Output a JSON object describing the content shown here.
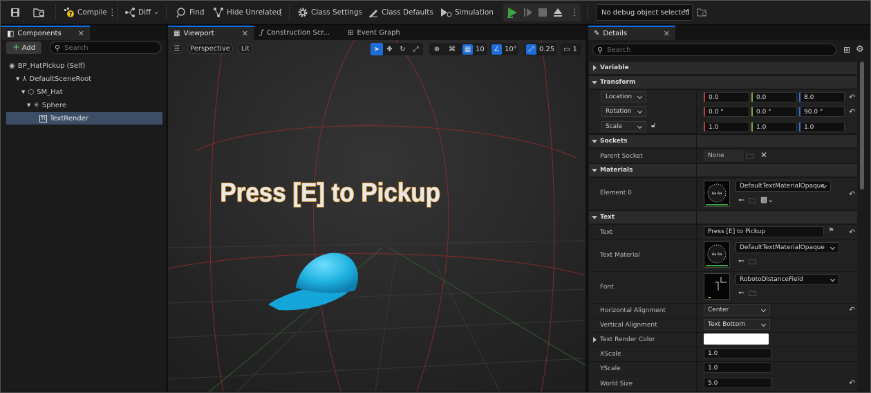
{
  "toolbar": {
    "compile": "Compile",
    "diff": "Diff",
    "find": "Find",
    "hide_unrelated": "Hide Unrelated",
    "class_settings": "Class Settings",
    "class_defaults": "Class Defaults",
    "simulation": "Simulation",
    "debug_object": "No debug object selected"
  },
  "tabs": {
    "components": "Components",
    "viewport": "Viewport",
    "construction_script": "Construction Scr...",
    "event_graph": "Event Graph",
    "details": "Details"
  },
  "components": {
    "add": "Add",
    "search_placeholder": "Search",
    "tree": [
      {
        "label": "BP_HatPickup (Self)"
      },
      {
        "label": "DefaultSceneRoot"
      },
      {
        "label": "SM_Hat"
      },
      {
        "label": "Sphere"
      },
      {
        "label": "TextRender"
      }
    ]
  },
  "viewport": {
    "perspective": "Perspective",
    "lit": "Lit",
    "grid_snap": "10",
    "rotation_snap": "10°",
    "scale_snap": "0.25",
    "camera_speed": "1",
    "text_render": "Press [E] to Pickup",
    "colors": {
      "hat": "#1fb3e0",
      "text_outline": "#f0a020",
      "grid_red": "#a82a2a",
      "grid_green": "#2f5a2f"
    }
  },
  "details": {
    "search_placeholder": "Search",
    "categories": {
      "variable": "Variable",
      "transform": "Transform",
      "sockets": "Sockets",
      "materials": "Materials",
      "text": "Text"
    },
    "transform": {
      "location": {
        "label": "Location",
        "x": "0.0",
        "y": "0.0",
        "z": "8.0"
      },
      "rotation": {
        "label": "Rotation",
        "x": "0.0 °",
        "y": "0.0 °",
        "z": "90.0 °"
      },
      "scale": {
        "label": "Scale",
        "x": "1.0",
        "y": "1.0",
        "z": "1.0"
      }
    },
    "sockets": {
      "parent_socket": "Parent Socket",
      "value": "None"
    },
    "materials": {
      "element0": "Element 0",
      "value": "DefaultTextMaterialOpaque"
    },
    "text": {
      "text_label": "Text",
      "text_value": "Press [E] to Pickup",
      "text_material_label": "Text Material",
      "text_material_value": "DefaultTextMaterialOpaque",
      "font_label": "Font",
      "font_value": "RobotoDistanceField",
      "halign_label": "Horizontal Alignment",
      "halign_value": "Center",
      "valign_label": "Vertical Alignment",
      "valign_value": "Text Bottom",
      "color_label": "Text Render Color",
      "xscale_label": "XScale",
      "xscale_value": "1.0",
      "yscale_label": "YScale",
      "yscale_value": "1.0",
      "worldsize_label": "World Size",
      "worldsize_value": "5.0"
    }
  }
}
